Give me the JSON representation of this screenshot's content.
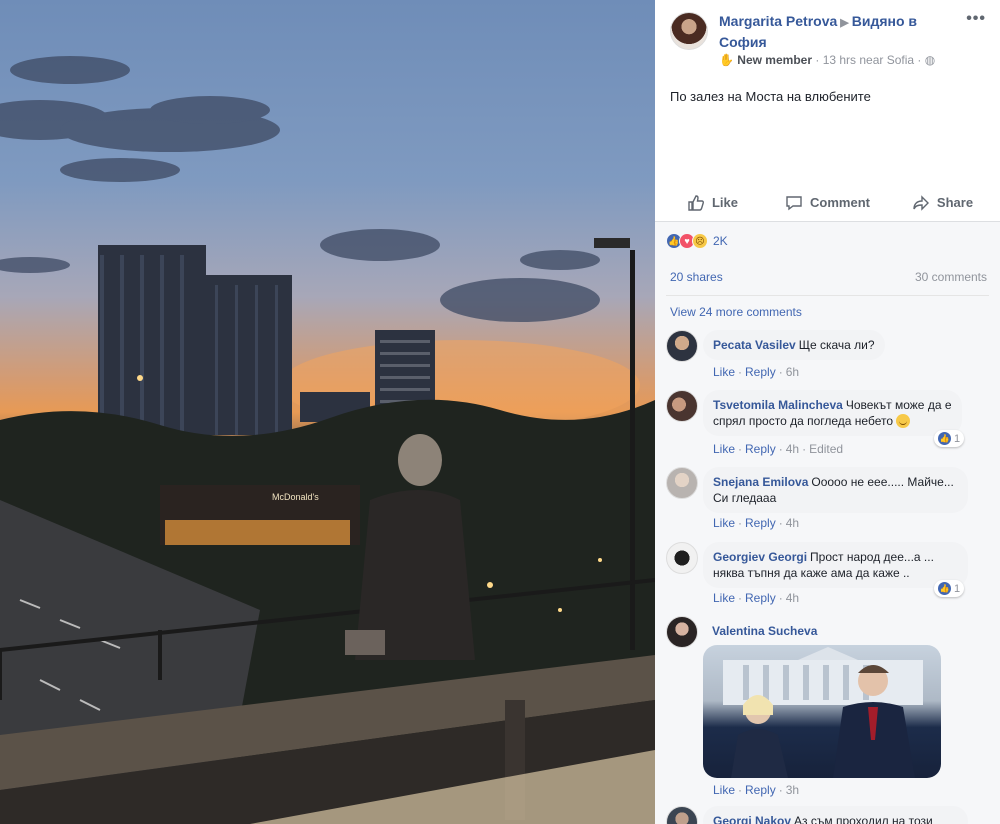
{
  "post": {
    "author": "Margarita Petrova",
    "checkin": "Видяно в София",
    "badge": "New member",
    "time": "13 hrs near Sofia",
    "text": "По залез на Моста на влюбените",
    "more_icon": "•••"
  },
  "actions": {
    "like": "Like",
    "comment": "Comment",
    "share": "Share"
  },
  "feedback": {
    "reaction_icons": [
      "like-icon",
      "love-icon",
      "sad-icon"
    ],
    "reaction_count": "2K",
    "shares": "20 shares",
    "comments": "30 comments",
    "view_more": "View 24 more comments"
  },
  "comments": [
    {
      "name": "Pecata Vasilev",
      "text": "Ще скача ли?",
      "like": "Like",
      "reply": "Reply",
      "time": "6h"
    },
    {
      "name": "Tsvetomila Malincheva",
      "text": "Човекът може да е спрял просто да погледа небето",
      "like": "Like",
      "reply": "Reply",
      "time": "4h",
      "edited": "Edited",
      "reactions": "1"
    },
    {
      "name": "Snejana Emilova",
      "text": "Ооооо не еее..... Майче... Си гледааа",
      "like": "Like",
      "reply": "Reply",
      "time": "4h"
    },
    {
      "name": "Georgiev Georgi",
      "text": "Прост народ дее...а ... няква тъпня да каже ама да каже ..",
      "like": "Like",
      "reply": "Reply",
      "time": "4h",
      "reactions": "1"
    },
    {
      "name": "Valentina Sucheva",
      "like": "Like",
      "reply": "Reply",
      "time": "3h"
    },
    {
      "name": "Georgi Nakov",
      "text": "Аз съм проходил на този"
    }
  ],
  "colors": {
    "link_blue": "#365899",
    "action_blue": "#4267b2",
    "muted": "#90949c",
    "feedback_bg": "#f6f7f9",
    "bubble_bg": "#f2f3f5"
  }
}
